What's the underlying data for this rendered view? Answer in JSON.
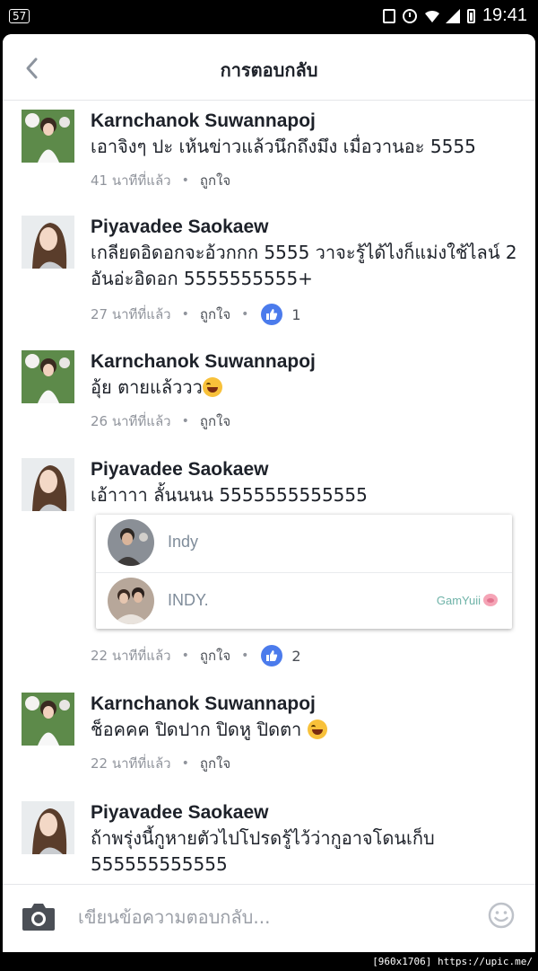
{
  "status_bar": {
    "notification_count": "57",
    "time": "19:41"
  },
  "header": {
    "title": "การตอบกลับ",
    "back_icon": "chevron-left-icon"
  },
  "comments": [
    {
      "name": "Karnchanok Suwannapoj",
      "text": "เอาจิงๆ ปะ เห้นข่าวแล้วนึกถึงมึง เมื่อวานอะ 5555",
      "time": "41 นาทีที่แล้ว",
      "like_label": "ถูกใจ",
      "likes": null
    },
    {
      "name": "Piyavadee Saokaew",
      "text": "เกลียดอิดอกจะอ้วกกก 5555 วาจะรู้ได้ไงก็แม่งใช้ไลน์ 2 อันอ่ะอิดอก 5555555555+",
      "time": "27 นาทีที่แล้ว",
      "like_label": "ถูกใจ",
      "likes": "1"
    },
    {
      "name": "Karnchanok Suwannapoj",
      "text": "อุ้ย ตายแล้ววว",
      "time": "26 นาทีที่แล้ว",
      "like_label": "ถูกใจ",
      "likes": null,
      "emoji": "laughing-tears-emoji"
    },
    {
      "name": "Piyavadee Saokaew",
      "text": "เอ้าาาา ลั้นนนน 5555555555555",
      "time": "22 นาทีที่แล้ว",
      "like_label": "ถูกใจ",
      "likes": "2"
    },
    {
      "name": "Karnchanok Suwannapoj",
      "text": "ช็อคคค ปิดปาก ปิดหู ปิดตา",
      "time": "22 นาทีที่แล้ว",
      "like_label": "ถูกใจ",
      "likes": null,
      "emoji": "laughing-tears-emoji"
    },
    {
      "name": "Piyavadee Saokaew",
      "text": "ถ้าพรุ่งนี้กูหายตัวไปโปรดรู้ไว้ว่ากูอาจโดนเก็บ 555555555555",
      "time": null,
      "like_label": null,
      "likes": null
    }
  ],
  "mention_suggestions": [
    {
      "name": "Indy",
      "extra": ""
    },
    {
      "name": "INDY.",
      "extra": "GamYuii"
    }
  ],
  "composer": {
    "placeholder": "เขียนข้อความตอบกลับ...",
    "camera_icon": "camera-icon",
    "emoji_icon": "smiley-icon"
  },
  "watermark": "[960x1706] https://upic.me/",
  "colors": {
    "like_blue": "#4b7bec",
    "meta_gray": "#90949c",
    "text_dark": "#1d2129"
  }
}
